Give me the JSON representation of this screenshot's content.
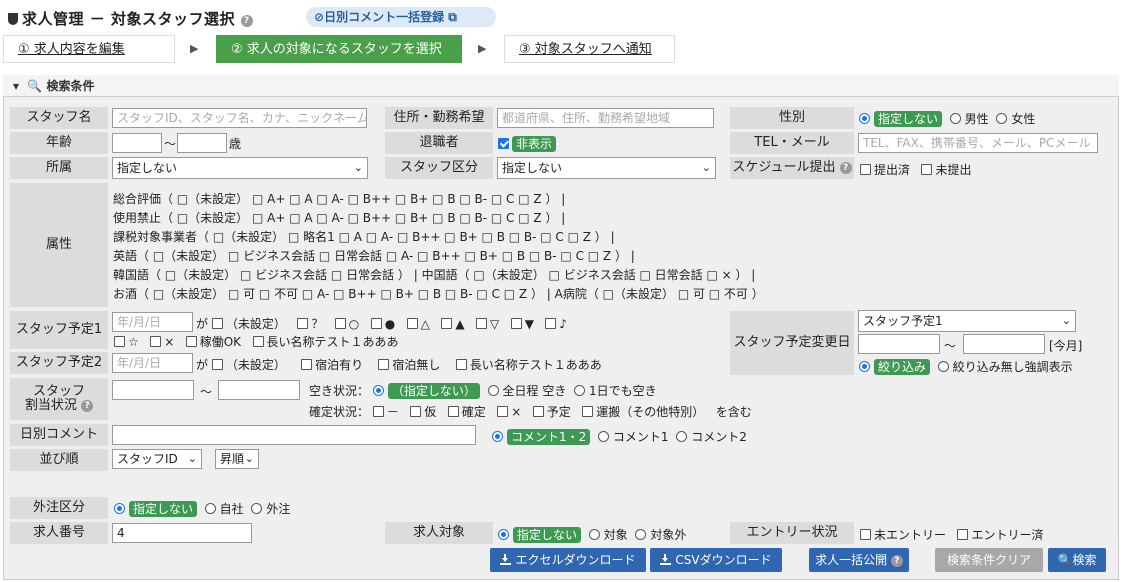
{
  "header": {
    "title": "求人管理 － 対象スタッフ選択",
    "bulk_comment": "日別コメント一括登録"
  },
  "steps": [
    "① 求人内容を編集",
    "② 求人の対象になるスタッフを選択",
    "③ 対象スタッフへ通知"
  ],
  "panel_title": "検索条件",
  "labels": {
    "staff_name": "スタッフ名",
    "address": "住所・勤務希望",
    "gender": "性別",
    "age": "年齢",
    "retired": "退職者",
    "tel_mail": "TEL・メール",
    "affiliation": "所属",
    "staff_type": "スタッフ区分",
    "schedule": "スケジュール提出",
    "attribute": "属性",
    "plan1": "スタッフ予定1",
    "plan2": "スタッフ予定2",
    "plan_change": "スタッフ予定変更日",
    "assign1": "スタッフ",
    "assign2": "割当状況",
    "daily_comment": "日別コメント",
    "sort": "並び順",
    "outsource": "外注区分",
    "job_no": "求人番号",
    "job_target": "求人対象",
    "entry": "エントリー状況"
  },
  "placeholders": {
    "staff_name": "スタッフID、スタッフ名、カナ、ニックネーム",
    "address": "都道府県、住所、勤務希望地域",
    "tel_mail": "TEL、FAX、携帯番号、メール、PCメール",
    "date": "年/月/日"
  },
  "gender": [
    "指定しない",
    "男性",
    "女性"
  ],
  "age_suffix": "歳",
  "tilde": "〜",
  "retired_value": "非表示",
  "affiliation_value": "指定しない",
  "staff_type_value": "指定しない",
  "schedule": [
    "提出済",
    "未提出"
  ],
  "attr_rows": [
    "総合評価（ □（未設定） □ A+ □ A □ A- □ B++ □ B+ □ B □ B- □ C □ Z ） |",
    "使用禁止（ □（未設定） □ A+ □ A □ A- □ B++ □ B+ □ B □ B- □ C □ Z ） |",
    "課税対象事業者（ □（未設定） □ 略名1 □ A □ A- □ B++ □ B+ □ B □ B- □ C □ Z ） |",
    "英語（ □（未設定） □ ビジネス会話 □ 日常会話 □ A- □ B++ □ B+ □ B □ B- □ C □ Z ） |",
    "韓国語（ □（未設定） □ ビジネス会話 □ 日常会話 ） | 中国語（ □（未設定） □ ビジネス会話 □ 日常会話 □ × ） |",
    "お酒（ □（未設定） □ 可 □ 不可 □ A- □ B++ □ B+ □ B □ B- □ C □ Z ） | A病院（ □（未設定） □ 可 □ 不可 ）"
  ],
  "plan1_ga": "が",
  "plan1_opts_a": [
    "（未設定）",
    "？",
    "○",
    "●",
    "△",
    "▲",
    "▽",
    "▼",
    "♪"
  ],
  "plan1_opts_b": [
    "☆",
    "×",
    "稼働OK",
    "長い名称テスト１あああ"
  ],
  "plan2_opts": [
    "（未設定）",
    "宿泊有り",
    "宿泊無し",
    "長い名称テスト１あああ"
  ],
  "plan_change": {
    "select": "スタッフ予定1",
    "today": "[今月]",
    "opts": [
      "絞り込み",
      "絞り込み無し強調表示"
    ]
  },
  "assign": {
    "vacancy_label": "空き状況：",
    "vacancy": [
      "（指定しない）",
      "全日程 空き",
      "1日でも空き"
    ],
    "confirm_label": "確定状況：",
    "confirm": [
      "－",
      "仮",
      "確定",
      "×",
      "予定",
      "運搬（その他特別）"
    ],
    "confirm_suffix": "を含む"
  },
  "comment_opts": [
    "コメント1・2",
    "コメント1",
    "コメント2"
  ],
  "sort": {
    "field": "スタッフID",
    "order": "昇順"
  },
  "outsource_opts": [
    "指定しない",
    "自社",
    "外注"
  ],
  "job_no_value": "4",
  "job_target_opts": [
    "指定しない",
    "対象",
    "対象外"
  ],
  "entry_opts": [
    "未エントリー",
    "エントリー済"
  ],
  "buttons": {
    "excel": "エクセルダウンロード",
    "csv": "CSVダウンロード",
    "publish": "求人一括公開",
    "clear": "検索条件クリア",
    "search": "検索"
  }
}
